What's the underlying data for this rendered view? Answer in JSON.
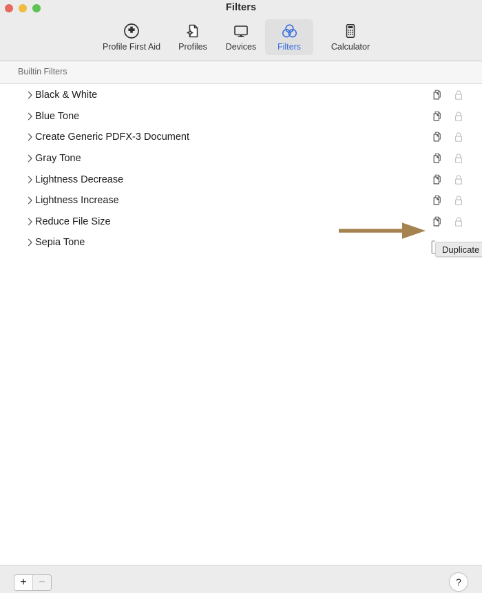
{
  "window": {
    "title": "Filters",
    "traffic_lights": [
      {
        "name": "close",
        "color": "#e8695e"
      },
      {
        "name": "minimize",
        "color": "#f0bc40"
      },
      {
        "name": "zoom",
        "color": "#5ec353"
      }
    ]
  },
  "toolbar": {
    "items": [
      {
        "id": "profile-first-aid",
        "label": "Profile First Aid",
        "icon": "first-aid-icon",
        "selected": false
      },
      {
        "id": "profiles",
        "label": "Profiles",
        "icon": "document-gear-icon",
        "selected": false
      },
      {
        "id": "devices",
        "label": "Devices",
        "icon": "display-icon",
        "selected": false
      },
      {
        "id": "filters",
        "label": "Filters",
        "icon": "venn-circles-icon",
        "selected": true
      },
      {
        "id": "calculator",
        "label": "Calculator",
        "icon": "calculator-icon",
        "selected": false
      }
    ],
    "selected_color": "#3b6fe0"
  },
  "section": {
    "header_label": "Builtin Filters"
  },
  "list": {
    "row_icons": {
      "disclosure": "chevron-right-icon",
      "duplicate": "duplicate-pages-icon",
      "lock": "lock-closed-icon"
    },
    "rows": [
      {
        "name": "Black & White"
      },
      {
        "name": "Blue Tone"
      },
      {
        "name": "Create Generic PDFX-3 Document"
      },
      {
        "name": "Gray Tone"
      },
      {
        "name": "Lightness Decrease"
      },
      {
        "name": "Lightness Increase"
      },
      {
        "name": "Reduce File Size"
      },
      {
        "name": "Sepia Tone"
      }
    ]
  },
  "annotation": {
    "arrow_color": "#a58250",
    "points_to": "duplicate-pages-icon of Reduce File Size row"
  },
  "tooltip": {
    "text": "Duplicate",
    "background": "#e9e9e9"
  },
  "bottom_bar": {
    "add_label": "+",
    "remove_label": "−",
    "help_label": "?"
  }
}
